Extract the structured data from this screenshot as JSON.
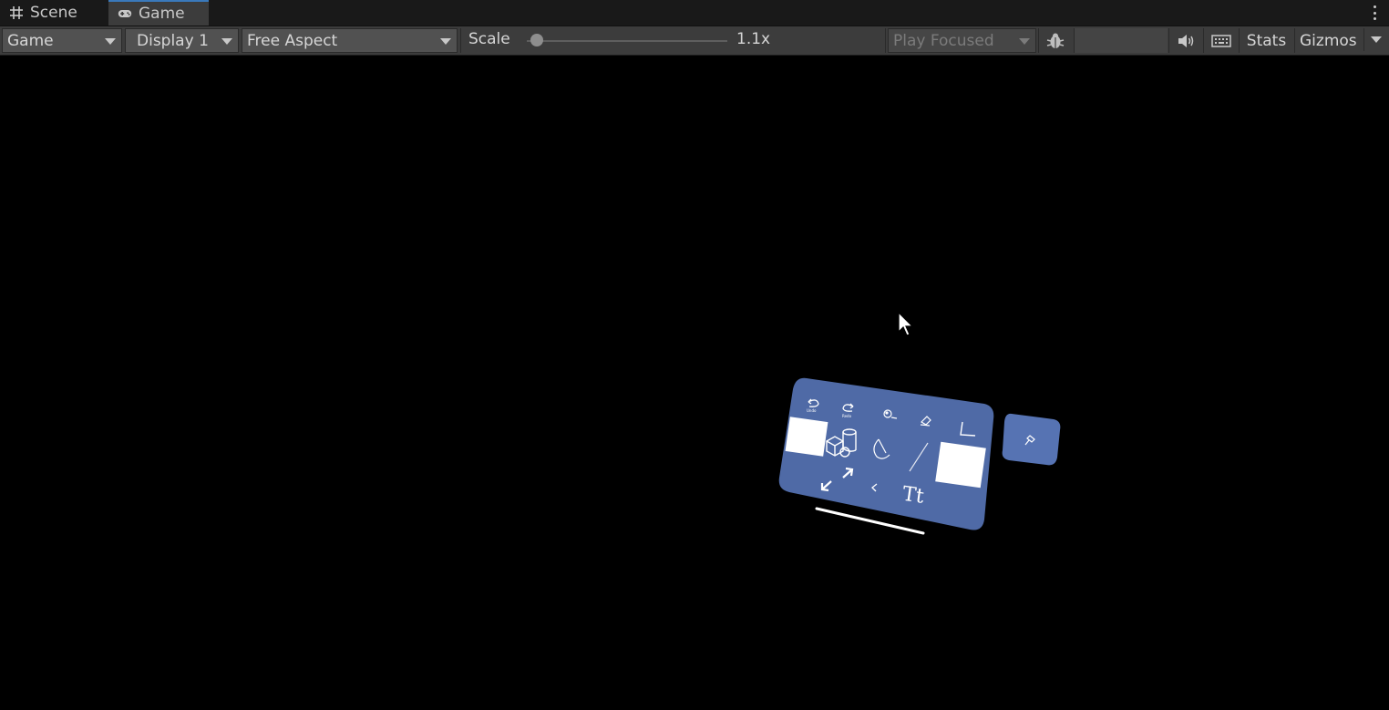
{
  "tabs": [
    {
      "label": "Scene",
      "icon": "grid-icon"
    },
    {
      "label": "Game",
      "icon": "gamepad-icon"
    }
  ],
  "toolbar": {
    "view_dropdown": "Game",
    "display_dropdown": "Display 1",
    "aspect_dropdown": "Free Aspect",
    "scale_label": "Scale",
    "scale_value": "1.1x",
    "scale_level": 0.02,
    "play_mode_dropdown": "Play Focused",
    "stats_label": "Stats",
    "gizmos_label": "Gizmos",
    "icons": [
      "bug-icon",
      "speaker-icon",
      "keyboard-icon"
    ]
  },
  "game": {
    "menu_panel": {
      "color": "#4f6aa6",
      "buttons": [
        "undo-icon",
        "redo-icon",
        "paint-icon",
        "eraser-icon",
        "axes-icon",
        "shapes-icon",
        "circle-icon",
        "line-icon",
        "resize-icon",
        "back-icon",
        "text-icon"
      ],
      "text_glyph": "Tt",
      "undo_caption": "Undo",
      "redo_caption": "Redo"
    },
    "pin_button": {
      "icon": "pin-icon",
      "color": "#5673b3"
    }
  },
  "colors": {
    "tabbar": "#191919",
    "toolbar": "#3c3c3c",
    "dropdown": "#515151",
    "active_tab_accent": "#3a79bb"
  }
}
